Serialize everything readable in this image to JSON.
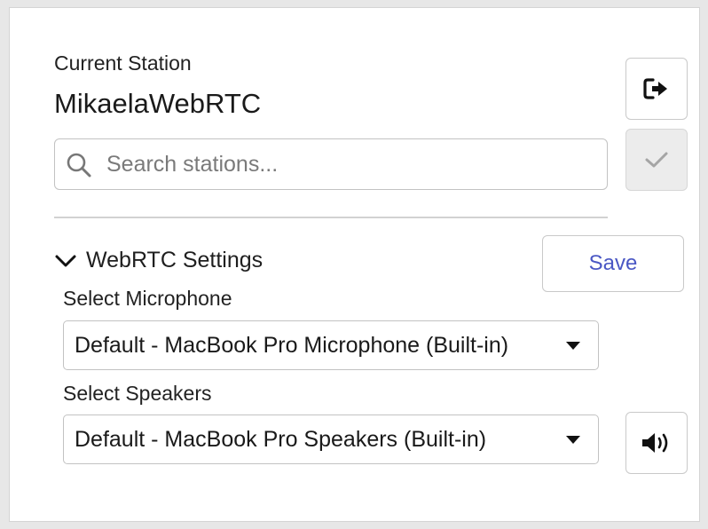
{
  "station": {
    "label": "Current Station",
    "name": "MikaelaWebRTC"
  },
  "search": {
    "placeholder": "Search stations..."
  },
  "icons": {
    "logout": "sign-out-icon",
    "confirm": "check-icon",
    "search": "search-icon",
    "chevron": "chevron-down-icon",
    "speaker": "volume-up-icon"
  },
  "settings": {
    "title": "WebRTC Settings",
    "save_label": "Save",
    "microphone": {
      "label": "Select Microphone",
      "selected": "Default - MacBook Pro Microphone (Built-in)"
    },
    "speakers": {
      "label": "Select Speakers",
      "selected": "Default - MacBook Pro Speakers (Built-in)"
    }
  },
  "colors": {
    "accent": "#4a57c4",
    "background": "#e7e7e7",
    "panel": "#ffffff",
    "disabled_button": "#ececec"
  }
}
